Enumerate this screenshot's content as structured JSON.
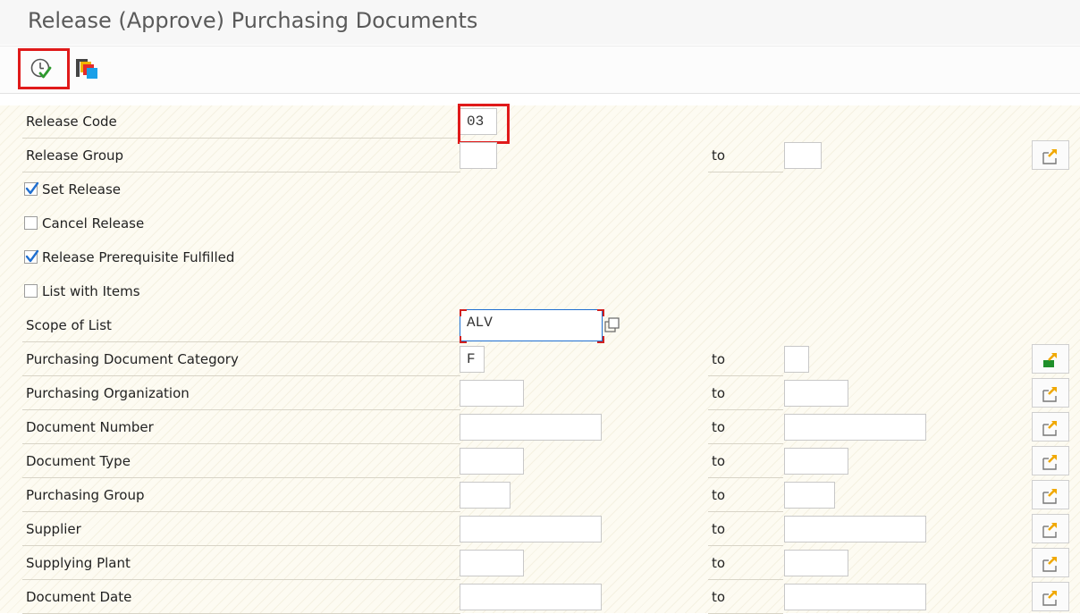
{
  "window": {
    "title": "Release (Approve) Purchasing Documents"
  },
  "toolbar": {
    "execute_icon": "execute-clock-check-icon",
    "variant_icon": "multi-window-icon"
  },
  "form": {
    "release_code": {
      "label": "Release Code",
      "value": "03"
    },
    "release_group": {
      "label": "Release Group",
      "to": "to",
      "value": "",
      "to_value": ""
    },
    "set_release": {
      "label": "Set Release",
      "checked": true
    },
    "cancel_release": {
      "label": "Cancel Release",
      "checked": false
    },
    "release_prerequisite": {
      "label": "Release Prerequisite Fulfilled",
      "checked": true
    },
    "list_with_items": {
      "label": "List with Items",
      "checked": false
    },
    "scope_of_list": {
      "label": "Scope of List",
      "value": "ALV"
    },
    "purch_doc_category": {
      "label": "Purchasing Document Category",
      "to": "to",
      "value": "F",
      "to_value": ""
    },
    "purch_org": {
      "label": "Purchasing Organization",
      "to": "to",
      "value": "",
      "to_value": ""
    },
    "doc_number": {
      "label": "Document Number",
      "to": "to",
      "value": "",
      "to_value": ""
    },
    "doc_type": {
      "label": "Document Type",
      "to": "to",
      "value": "",
      "to_value": ""
    },
    "purch_group": {
      "label": "Purchasing Group",
      "to": "to",
      "value": "",
      "to_value": ""
    },
    "supplier": {
      "label": "Supplier",
      "to": "to",
      "value": "",
      "to_value": ""
    },
    "supplying_plant": {
      "label": "Supplying Plant",
      "to": "to",
      "value": "",
      "to_value": ""
    },
    "doc_date": {
      "label": "Document Date",
      "to": "to",
      "value": "",
      "to_value": ""
    }
  },
  "colors": {
    "highlight": "#e01a1a",
    "multi_select_arrow": "#f0a800",
    "multi_select_active": "#1f8f2a",
    "checkbox_check": "#1f6fd0"
  }
}
